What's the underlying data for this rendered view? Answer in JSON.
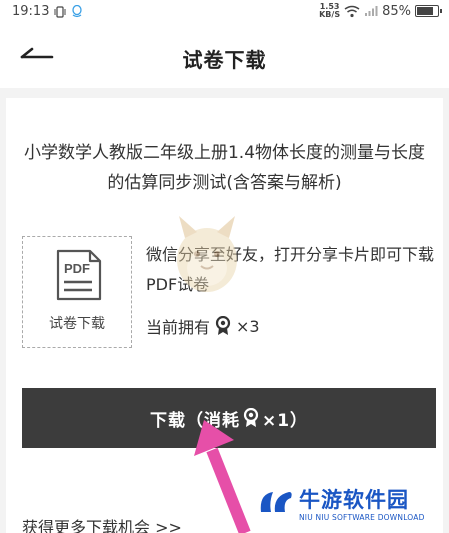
{
  "status_bar": {
    "time": "19:13",
    "net_speed_value": "1.53",
    "net_speed_unit": "KB/S",
    "battery": "85%",
    "battery_level": 0.85
  },
  "nav": {
    "title": "试卷下载"
  },
  "document": {
    "title": "小学数学人教版二年级上册1.4物体长度的测量与长度的估算同步测试(含答案与解析)",
    "file_label": "试卷下载",
    "pdf_text": "PDF"
  },
  "share": {
    "text": "微信分享至好友，打开分享卡片即可下载PDF试卷",
    "owned_prefix": "当前拥有",
    "owned_count": "×3"
  },
  "download_button": {
    "prefix": "下载（消耗",
    "suffix": "×1）"
  },
  "more": {
    "label": "获得更多下载机会 >>"
  },
  "watermark": {
    "brand_name": "牛游软件园",
    "brand_sub": "NIU NIU SOFTWARE DOWNLOAD"
  },
  "colors": {
    "button_bg": "#3c3c3c",
    "brand_blue": "#1a56c4",
    "arrow_pink": "#e64fa8"
  },
  "icons": {
    "back": "back-arrow-icon",
    "pdf": "pdf-document-icon",
    "medal": "medal-icon",
    "wifi": "wifi-icon",
    "signal": "signal-icon",
    "battery": "battery-icon"
  }
}
